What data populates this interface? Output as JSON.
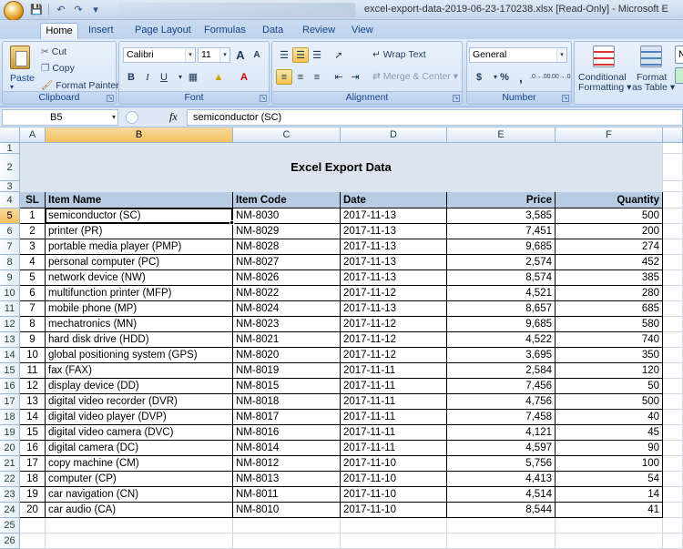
{
  "window": {
    "title": "excel-export-data-2019-06-23-170238.xlsx  [Read-Only] - Microsoft E"
  },
  "ribbon_tabs": [
    "Home",
    "Insert",
    "Page Layout",
    "Formulas",
    "Data",
    "Review",
    "View"
  ],
  "clipboard": {
    "paste": "Paste",
    "cut": "Cut",
    "copy": "Copy",
    "format_painter": "Format Painter",
    "label": "Clipboard"
  },
  "font": {
    "name": "Calibri",
    "size": "11",
    "bold": "B",
    "italic": "I",
    "underline": "U",
    "label": "Font",
    "grow": "A",
    "shrink": "A"
  },
  "alignment": {
    "wrap": "Wrap Text",
    "merge": "Merge & Center",
    "label": "Alignment"
  },
  "number": {
    "format": "General",
    "currency": "$",
    "percent": "%",
    "comma": ",",
    "inc_dec": ".0→.00",
    "dec_dec": ".00→.0",
    "label": "Number"
  },
  "styles": {
    "conditional": "Conditional",
    "conditional2": "Formatting",
    "format_table": "Format",
    "format_table2": "as Table",
    "normal": "N"
  },
  "formula_bar": {
    "cell_ref": "B5",
    "fx": "fx",
    "content": "semiconductor (SC)"
  },
  "columns": [
    "A",
    "B",
    "C",
    "D",
    "E",
    "F"
  ],
  "sheet": {
    "title": "Excel Export Data",
    "headers": {
      "sl": "SL",
      "name": "Item Name",
      "code": "Item Code",
      "date": "Date",
      "price": "Price",
      "qty": "Quantity"
    },
    "rows": [
      [
        "1",
        "semiconductor (SC)",
        "NM-8030",
        "2017-11-13",
        "3,585",
        "500"
      ],
      [
        "2",
        "printer (PR)",
        "NM-8029",
        "2017-11-13",
        "7,451",
        "200"
      ],
      [
        "3",
        "portable media player (PMP)",
        "NM-8028",
        "2017-11-13",
        "9,685",
        "274"
      ],
      [
        "4",
        "personal computer (PC)",
        "NM-8027",
        "2017-11-13",
        "2,574",
        "452"
      ],
      [
        "5",
        "network device (NW)",
        "NM-8026",
        "2017-11-13",
        "8,574",
        "385"
      ],
      [
        "6",
        "multifunction printer (MFP)",
        "NM-8022",
        "2017-11-12",
        "4,521",
        "280"
      ],
      [
        "7",
        "mobile phone (MP)",
        "NM-8024",
        "2017-11-13",
        "8,657",
        "685"
      ],
      [
        "8",
        "mechatronics (MN)",
        "NM-8023",
        "2017-11-12",
        "9,685",
        "580"
      ],
      [
        "9",
        "hard disk drive (HDD)",
        "NM-8021",
        "2017-11-12",
        "4,522",
        "740"
      ],
      [
        "10",
        "global positioning system (GPS)",
        "NM-8020",
        "2017-11-12",
        "3,695",
        "350"
      ],
      [
        "11",
        "fax (FAX)",
        "NM-8019",
        "2017-11-11",
        "2,584",
        "120"
      ],
      [
        "12",
        "display device (DD)",
        "NM-8015",
        "2017-11-11",
        "7,456",
        "50"
      ],
      [
        "13",
        "digital video recorder (DVR)",
        "NM-8018",
        "2017-11-11",
        "4,756",
        "500"
      ],
      [
        "14",
        "digital video player (DVP)",
        "NM-8017",
        "2017-11-11",
        "7,458",
        "40"
      ],
      [
        "15",
        "digital video camera (DVC)",
        "NM-8016",
        "2017-11-11",
        "4,121",
        "45"
      ],
      [
        "16",
        "digital camera (DC)",
        "NM-8014",
        "2017-11-11",
        "4,597",
        "90"
      ],
      [
        "17",
        "copy machine (CM)",
        "NM-8012",
        "2017-11-10",
        "5,756",
        "100"
      ],
      [
        "18",
        "computer (CP)",
        "NM-8013",
        "2017-11-10",
        "4,413",
        "54"
      ],
      [
        "19",
        "car navigation (CN)",
        "NM-8011",
        "2017-11-10",
        "4,514",
        "14"
      ],
      [
        "20",
        "car audio (CA)",
        "NM-8010",
        "2017-11-10",
        "8,544",
        "41"
      ]
    ],
    "row_numbers": [
      "1",
      "2",
      "3",
      "4",
      "5",
      "6",
      "7",
      "8",
      "9",
      "10",
      "11",
      "12",
      "13",
      "14",
      "15",
      "16",
      "17",
      "18",
      "19",
      "20",
      "21",
      "22",
      "23",
      "24",
      "25",
      "26"
    ]
  },
  "colors": {
    "header_fill": "#b8cce4",
    "title_fill": "#dbe4ef",
    "selection": "#f1c15f"
  }
}
